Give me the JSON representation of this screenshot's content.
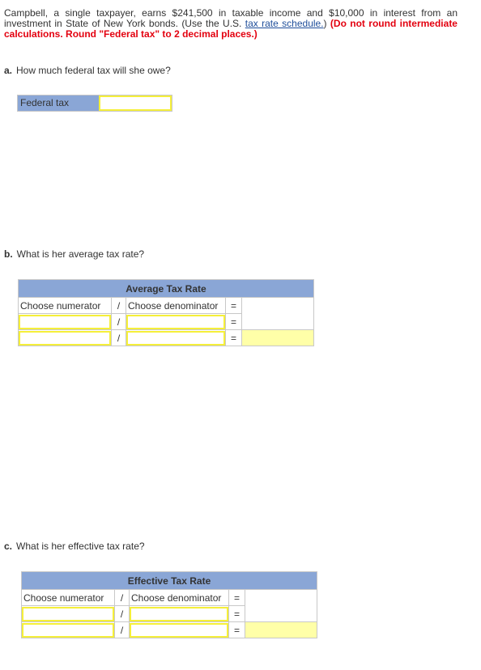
{
  "intro": {
    "text_before_link": "Campbell, a single taxpayer, earns $241,500 in taxable income and $10,000 in interest from an investment in State of New York bonds. (Use the U.S. ",
    "link_text": "tax rate schedule.",
    "text_after_link": ") ",
    "warning": "(Do not round intermediate calculations. Round \"Federal tax\" to 2 decimal places.)"
  },
  "part_a": {
    "letter": "a.",
    "question": "How much federal tax will she owe?",
    "field_label": "Federal tax",
    "field_value": ""
  },
  "part_b": {
    "letter": "b.",
    "question": "What is her average tax rate?",
    "table_title": "Average Tax Rate",
    "numerator_header": "Choose numerator",
    "denominator_header": "Choose denominator",
    "slash": "/",
    "equals": "=",
    "rows": [
      {
        "numerator": "",
        "denominator": "",
        "result": ""
      },
      {
        "numerator": "",
        "denominator": "",
        "result": ""
      }
    ]
  },
  "part_c": {
    "letter": "c.",
    "question": "What is her effective tax rate?",
    "table_title": "Effective Tax Rate",
    "numerator_header": "Choose numerator",
    "denominator_header": "Choose denominator",
    "slash": "/",
    "equals": "=",
    "rows": [
      {
        "numerator": "",
        "denominator": "",
        "result": ""
      },
      {
        "numerator": "",
        "denominator": "",
        "result": ""
      }
    ]
  }
}
